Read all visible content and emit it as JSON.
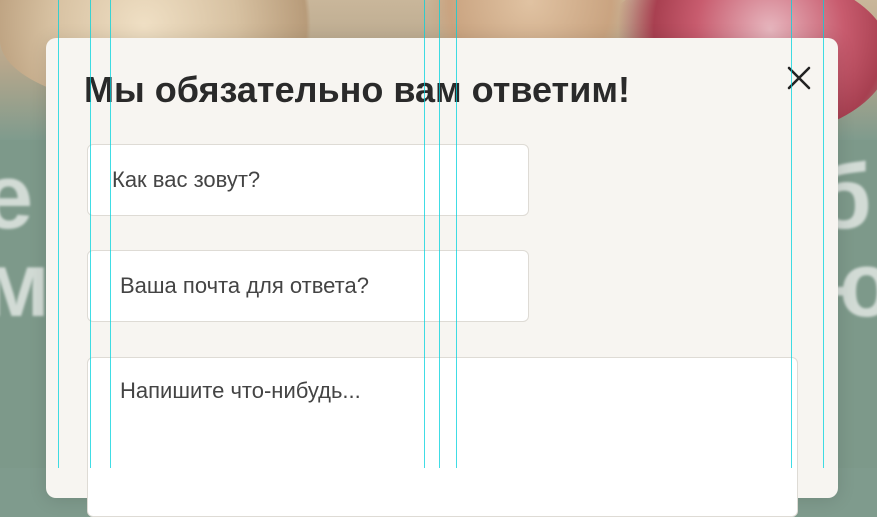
{
  "modal": {
    "title": "Мы обязательно вам ответим!",
    "fields": {
      "name_placeholder": "Как вас зовут?",
      "email_placeholder": "Ваша почта для ответа?",
      "message_placeholder": "Напишите что-нибудь..."
    }
  },
  "icons": {
    "close": "close-icon"
  },
  "colors": {
    "modal_bg": "#f7f5f1",
    "text": "#2a2a2a",
    "page_bg": "#7f9b8d",
    "guide": "#00d2dc"
  }
}
